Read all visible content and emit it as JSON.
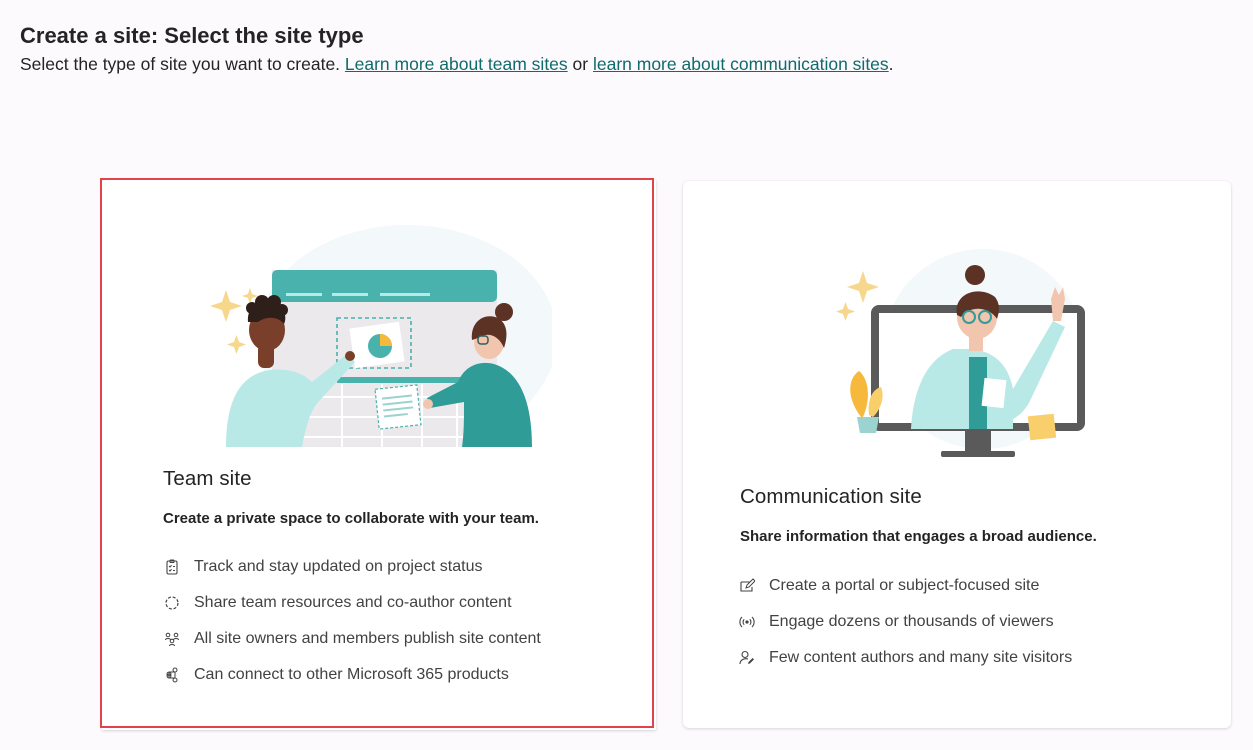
{
  "header": {
    "title": "Create a site: Select the site type",
    "subtitle_prefix": "Select the type of site you want to create. ",
    "link_team": "Learn more about team sites",
    "subtitle_middle": " or ",
    "link_comm": "learn more about communication sites",
    "subtitle_suffix": "."
  },
  "cards": {
    "team": {
      "title": "Team site",
      "description": "Create a private space to collaborate with your team.",
      "features": [
        {
          "icon": "checklist-icon",
          "text": "Track and stay updated on project status"
        },
        {
          "icon": "sync-circle-icon",
          "text": "Share team resources and co-author content"
        },
        {
          "icon": "people-icon",
          "text": "All site owners and members publish site content"
        },
        {
          "icon": "connect-icon",
          "text": "Can connect to other Microsoft 365 products"
        }
      ]
    },
    "communication": {
      "title": "Communication site",
      "description": "Share information that engages a broad audience.",
      "features": [
        {
          "icon": "compose-icon",
          "text": "Create a portal or subject-focused site"
        },
        {
          "icon": "broadcast-icon",
          "text": "Engage dozens or thousands of viewers"
        },
        {
          "icon": "person-edit-icon",
          "text": "Few content authors and many site visitors"
        }
      ]
    }
  },
  "colors": {
    "accent_teal": "#0f6b6b",
    "selection_red": "#e0434b",
    "illustration_teal": "#4ab2ad",
    "illustration_light": "#b9e9e6"
  }
}
